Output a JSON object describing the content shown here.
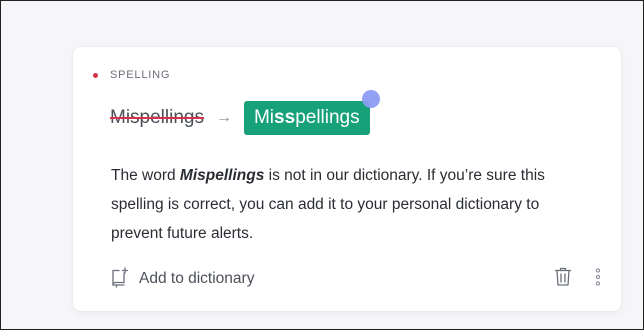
{
  "card": {
    "category": "SPELLING",
    "original": "Mispellings",
    "arrow": "→",
    "replacement_prefix": "Mi",
    "replacement_bold": "ss",
    "replacement_suffix": "pellings",
    "explanation": {
      "prefix": "The word ",
      "word": "Mispellings",
      "suffix": " is not in our dictionary. If you’re sure this spelling is correct, you can add it to your personal dictionary to prevent future alerts."
    },
    "add_to_dictionary": "Add to dictionary"
  },
  "icons": {
    "add_dictionary": "add-to-dictionary-icon",
    "delete": "trash-icon",
    "more": "more-options-icon"
  },
  "colors": {
    "accent": "#17a179",
    "category_dot": "#d6334b",
    "strike": "#d6334b",
    "pointer": "#8c9cf2"
  }
}
